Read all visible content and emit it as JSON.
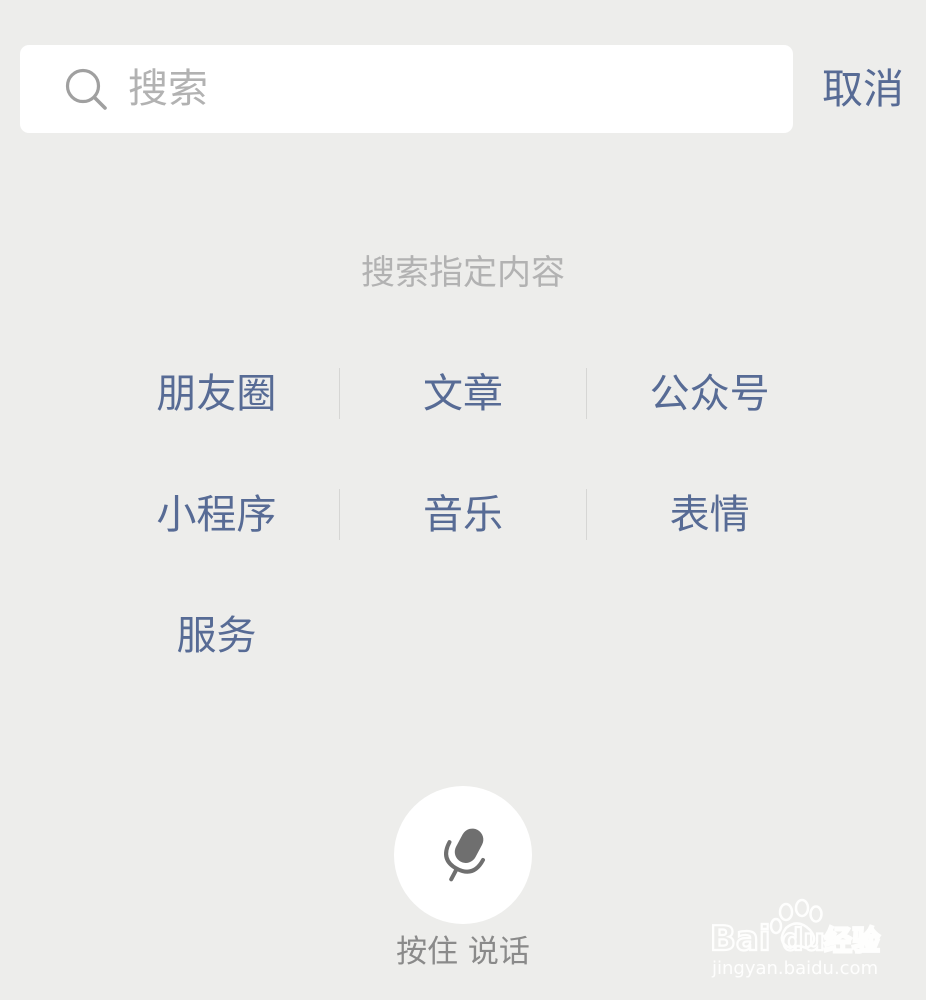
{
  "search": {
    "placeholder": "搜索",
    "value": ""
  },
  "header": {
    "cancel_label": "取消"
  },
  "section": {
    "title": "搜索指定内容"
  },
  "categories": [
    [
      "朋友圈",
      "文章",
      "公众号"
    ],
    [
      "小程序",
      "音乐",
      "表情"
    ],
    [
      "服务"
    ]
  ],
  "voice": {
    "label": "按住 说话",
    "icon": "microphone-icon"
  },
  "watermark": {
    "logo_text": "Bai du 经验",
    "url": "jingyan.baidu.com"
  },
  "colors": {
    "background": "#ededeb",
    "link": "#576b95",
    "placeholder": "#b2b2b2",
    "icon": "#6f6f6f"
  }
}
